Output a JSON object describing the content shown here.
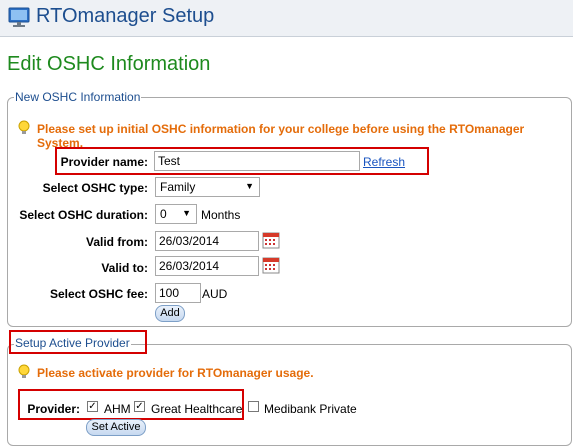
{
  "app": {
    "title": "RTOmanager Setup"
  },
  "page": {
    "title": "Edit OSHC Information"
  },
  "section_oshc": {
    "legend": "New OSHC Information",
    "warning": "Please set up initial OSHC information for your college before using the RTOmanager System.",
    "provider_label": "Provider name:",
    "provider_value": "Test",
    "refresh_label": "Refresh",
    "type_label": "Select OSHC type:",
    "type_value": "Family",
    "duration_label": "Select OSHC duration:",
    "duration_value": "0",
    "duration_unit": "Months",
    "valid_from_label": "Valid from:",
    "valid_from_value": "26/03/2014",
    "valid_to_label": "Valid to:",
    "valid_to_value": "26/03/2014",
    "fee_label": "Select OSHC fee:",
    "fee_value": "100",
    "fee_unit": "AUD",
    "add_label": "Add"
  },
  "section_active": {
    "legend": "Setup Active Provider",
    "warning": "Please activate provider for RTOmanager usage.",
    "provider_label": "Provider:",
    "providers": [
      {
        "name": "AHM",
        "checked": true
      },
      {
        "name": "Great Healthcare",
        "checked": true
      },
      {
        "name": "Medibank Private",
        "checked": false
      }
    ],
    "set_active_label": "Set Active"
  },
  "colors": {
    "title_blue": "#1d4e8f",
    "page_title_green": "#1e8a1e",
    "warning_orange": "#e46c0a",
    "highlight_red": "#d40000",
    "link_blue": "#1a55c0"
  }
}
